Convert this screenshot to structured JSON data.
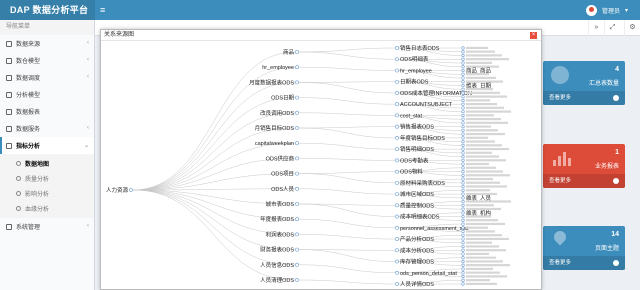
{
  "header": {
    "logo_text": "DAP  数据分析平台",
    "menu_icon": "menu-icon",
    "user_name": "管理员"
  },
  "sidebar": {
    "header": "导航菜单",
    "items": [
      {
        "label": "数据来源",
        "icon": "database-icon"
      },
      {
        "label": "数仓模型",
        "icon": "model-icon"
      },
      {
        "label": "数据调度",
        "icon": "schedule-icon"
      },
      {
        "label": "分析模型",
        "icon": "analysis-icon"
      },
      {
        "label": "数据报表",
        "icon": "report-icon"
      },
      {
        "label": "数据服务",
        "icon": "service-icon"
      },
      {
        "label": "指标分析",
        "icon": "metric-icon"
      }
    ],
    "subitems": [
      "数据地图",
      "质量分析",
      "影响分析",
      "血缘分析"
    ],
    "last_item": {
      "label": "系统管理",
      "icon": "settings-icon"
    }
  },
  "tabs_bar": {
    "buttons": [
      "»",
      "⤢",
      "⟳",
      "⚙"
    ]
  },
  "info_boxes": [
    {
      "num": "4",
      "label": "汇总表数量",
      "more": "查看更多",
      "color": "#3c8dbc"
    },
    {
      "num": "1",
      "label": "业务报表",
      "more": "查看更多",
      "color": "#dd4b39"
    },
    {
      "num": "14",
      "label": "页面主题",
      "more": "查看更多",
      "color": "#3c8dbc"
    }
  ],
  "dialog": {
    "title": "关系来源图",
    "close": "×"
  },
  "tree": {
    "root": "人力资源",
    "mid": [
      "商品",
      "hr_employee",
      "月度数据报表ODS",
      "ODS日期",
      "改良调用ODS",
      "月销售目标ODS",
      "capitalweekplan",
      "ODS供应商",
      "ODS项目",
      "ODS人员",
      "城市表ODS",
      "年度报表ODS",
      "利润表ODS",
      "财务报表ODS",
      "人员信息ODS",
      "人员清理ODS"
    ],
    "branch": [
      "销售日志表ODS",
      "ODS明细表",
      "hr_employee",
      "日期表ODS",
      "ODS成本管理INFORMATION",
      "ACCOUNTSUBJECT",
      "cost_stat",
      "销售报表ODS",
      "年度销售目标ODS",
      "销售明细ODS",
      "ODS考勤表",
      "ODS物料",
      "原材料采购表ODS",
      "城市区域ODS",
      "质量控制ODS",
      "成本明细表ODS",
      "personnel_assessment_stat",
      "产品分析ODS",
      "成本分析ODS",
      "库存管理ODS",
      "ods_person_detail_stat",
      "人员详情ODS"
    ],
    "leaf_group_a": [
      "商品_商品",
      "维表_日期"
    ],
    "leaf_group_b": [
      "维表_人员",
      "维表_机构"
    ]
  }
}
